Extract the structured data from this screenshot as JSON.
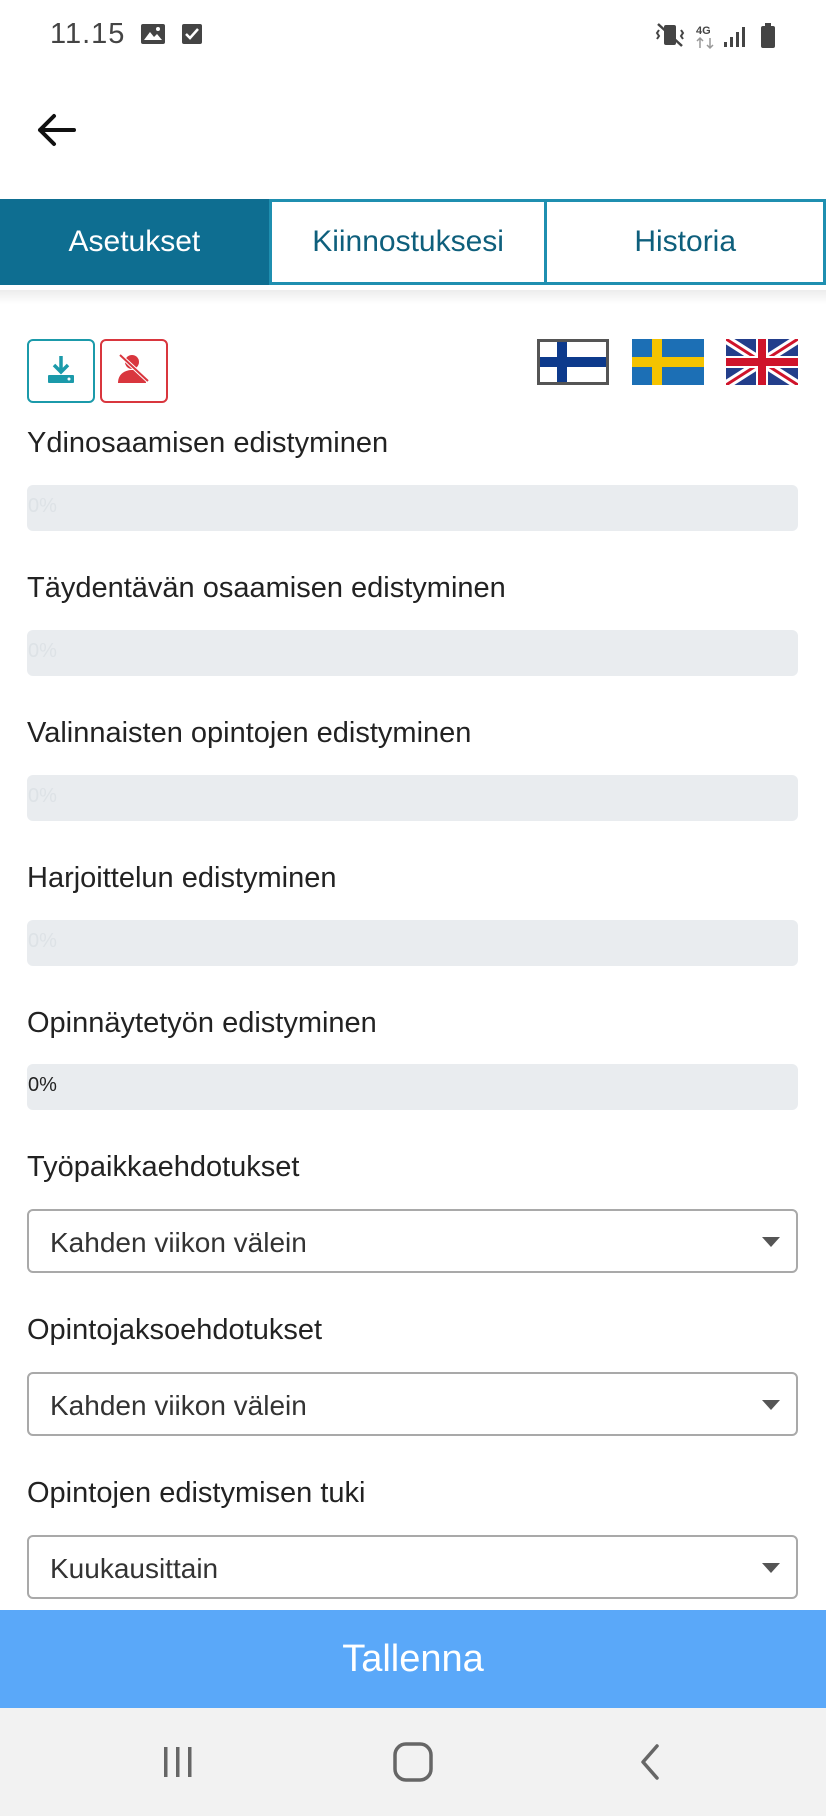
{
  "status_bar": {
    "time": "11.15",
    "icons": [
      "image-icon",
      "check-box-icon",
      "vibrate-icon",
      "network-4g-icon",
      "signal-icon",
      "battery-icon"
    ],
    "network_label": "4G"
  },
  "app_bar": {
    "back_icon": "arrow-left-icon"
  },
  "tabs": [
    {
      "label": "Asetukset",
      "active": true
    },
    {
      "label": "Kiinnostuksesi",
      "active": false
    },
    {
      "label": "Historia",
      "active": false
    }
  ],
  "toolbar": {
    "download_icon": "download-icon",
    "remove_icon": "remove-user-icon",
    "flags": [
      "finland-flag-icon",
      "sweden-flag-icon",
      "uk-flag-icon"
    ]
  },
  "progress": [
    {
      "label": "Ydinosaamisen edistyminen",
      "value_text": "0%",
      "value": 0
    },
    {
      "label": "Täydentävän osaamisen edistyminen",
      "value_text": "0%",
      "value": 0
    },
    {
      "label": "Valinnaisten opintojen edistyminen",
      "value_text": "0%",
      "value": 0
    },
    {
      "label": "Harjoittelun edistyminen",
      "value_text": "0%",
      "value": 0
    },
    {
      "label": "Opinnäytetyön edistyminen",
      "value_text": "0%",
      "value": 0
    }
  ],
  "selects": [
    {
      "label": "Työpaikkaehdotukset",
      "value": "Kahden viikon välein"
    },
    {
      "label": "Opintojaksoehdotukset",
      "value": "Kahden viikon välein"
    },
    {
      "label": "Opintojen edistymisen tuki",
      "value": "Kuukausittain"
    }
  ],
  "save_button": {
    "label": "Tallenna"
  },
  "nav_bar": {
    "icons": [
      "recent-apps-icon",
      "home-icon",
      "back-nav-icon"
    ]
  },
  "colors": {
    "primary": "#0e6e91",
    "tab_border": "#1f8fb0",
    "danger": "#d9363e",
    "teal": "#1b9aaa",
    "save": "#5aa8f9",
    "progress_track": "#e9ecef"
  }
}
